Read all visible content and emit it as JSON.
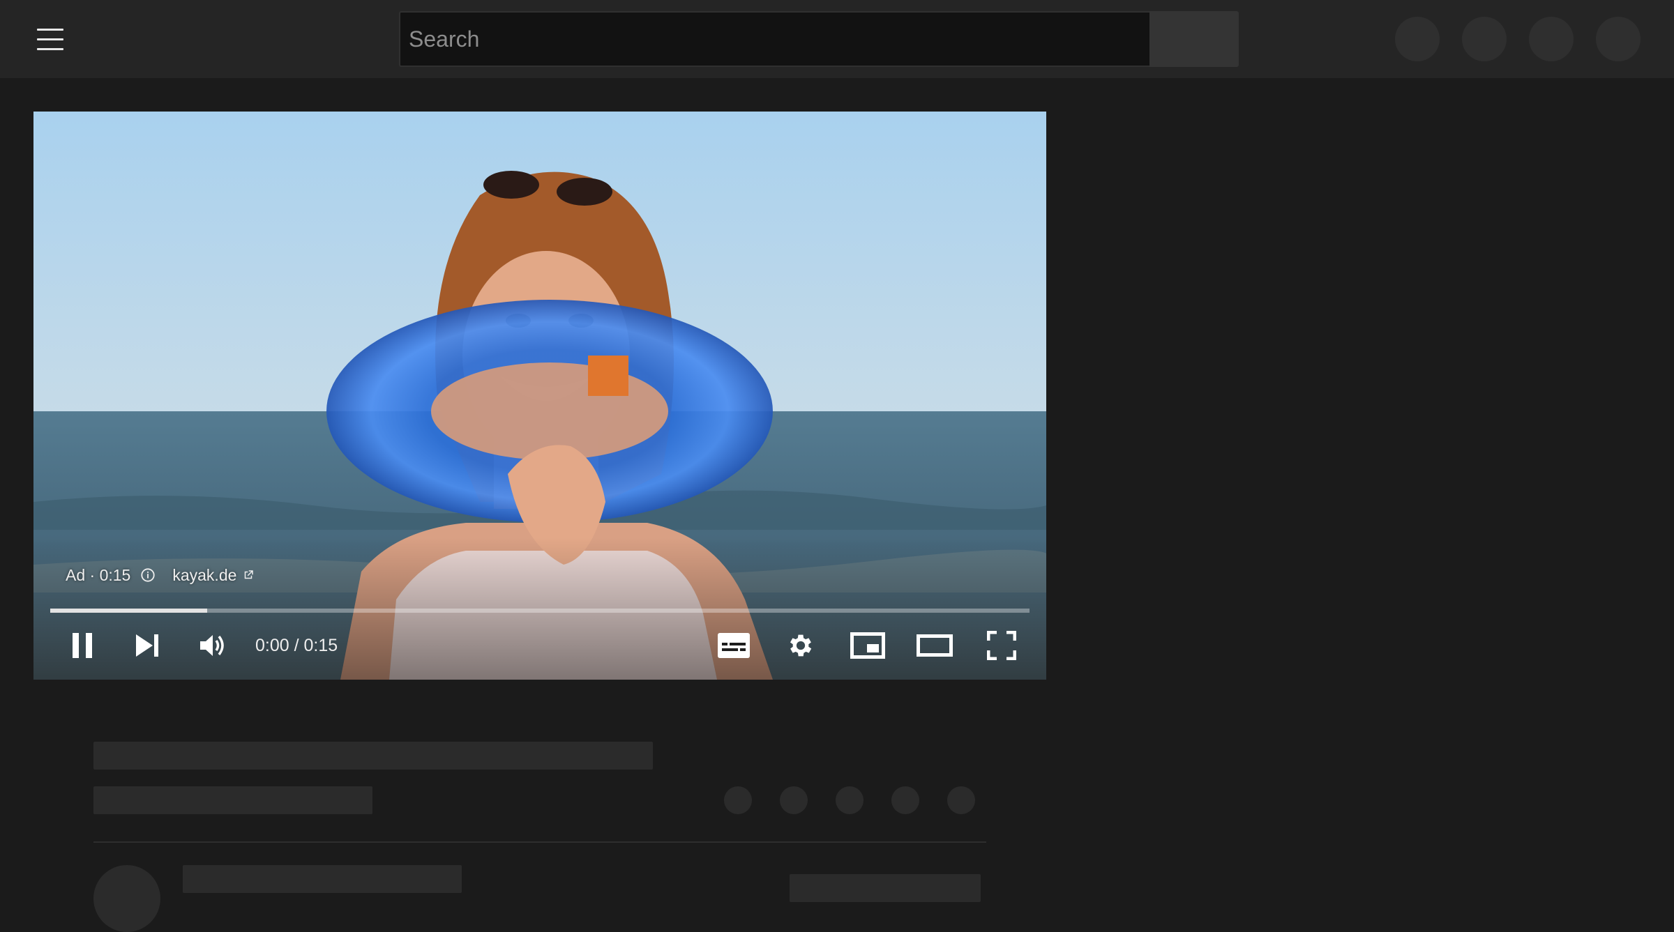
{
  "search": {
    "placeholder": "Search"
  },
  "ad": {
    "label": "Ad · 0:15",
    "advertiser": "kayak.de"
  },
  "player": {
    "time": "0:00 / 0:15",
    "progress_fraction": 0.16
  },
  "icons": {
    "menu": "hamburger-menu-icon",
    "info": "info-icon",
    "external": "external-link-icon",
    "pause": "pause-icon",
    "next": "skip-next-icon",
    "volume": "volume-icon",
    "subtitles": "subtitles-icon",
    "settings": "gear-icon",
    "miniplayer": "miniplayer-icon",
    "theater": "theater-mode-icon",
    "fullscreen": "fullscreen-icon"
  },
  "colors": {
    "background": "#1b1b1b",
    "masthead": "#252525",
    "skeleton": "#2b2b2b"
  }
}
